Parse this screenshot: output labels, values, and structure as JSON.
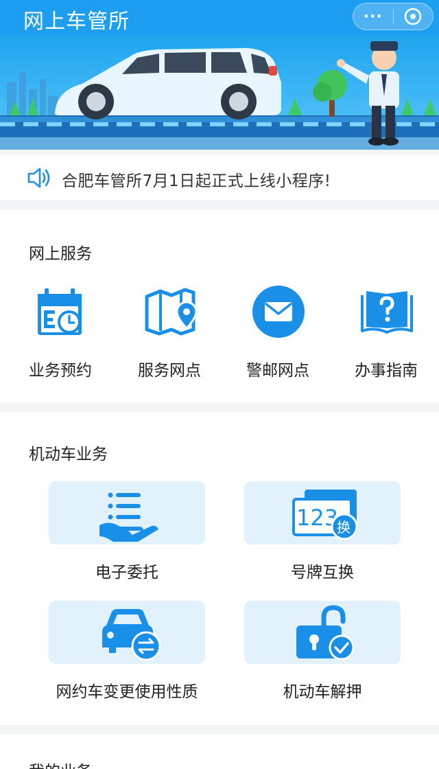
{
  "header": {
    "title": "网上车管所",
    "more_label": "···"
  },
  "notice": {
    "text": "合肥车管所7月1日起正式上线小程序!"
  },
  "online_services": {
    "title": "网上服务",
    "items": [
      {
        "label": "业务预约",
        "icon": "calendar-clock-icon"
      },
      {
        "label": "服务网点",
        "icon": "map-pin-icon"
      },
      {
        "label": "警邮网点",
        "icon": "mail-icon"
      },
      {
        "label": "办事指南",
        "icon": "book-question-icon"
      }
    ]
  },
  "vehicle_services": {
    "title": "机动车业务",
    "items": [
      {
        "label": "电子委托",
        "icon": "hand-list-icon"
      },
      {
        "label": "号牌互换",
        "icon": "plate-swap-icon",
        "plate_text": "123",
        "badge": "换"
      },
      {
        "label": "网约车变更使用性质",
        "icon": "car-swap-icon"
      },
      {
        "label": "机动车解押",
        "icon": "unlock-icon"
      }
    ]
  },
  "my_services": {
    "title": "我的业务"
  },
  "colors": {
    "primary": "#1e9ef0",
    "icon_blue": "#1a8fe8",
    "card_bg": "#e1f2fd",
    "banner_sky": "#2aaef2"
  }
}
